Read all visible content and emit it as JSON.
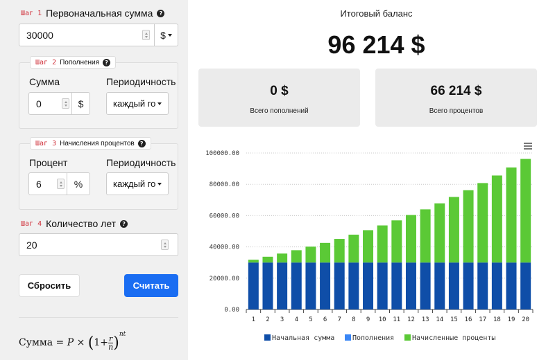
{
  "steps": {
    "s1": {
      "tag": "Шаг 1",
      "label": "Первоначальная сумма",
      "value": "30000",
      "currency": "$"
    },
    "s2": {
      "tag": "Шаг 2",
      "label": "Пополнения",
      "amount_label": "Сумма",
      "amount_value": "0",
      "amount_unit": "$",
      "period_label": "Периодичность",
      "period_value": "каждый го"
    },
    "s3": {
      "tag": "Шаг 3",
      "label": "Начисления процентов",
      "rate_label": "Процент",
      "rate_value": "6",
      "rate_unit": "%",
      "period_label": "Периодичность",
      "period_value": "каждый го"
    },
    "s4": {
      "tag": "Шаг 4",
      "label": "Количество лет",
      "value": "20"
    }
  },
  "buttons": {
    "reset": "Сбросить",
    "calc": "Считать"
  },
  "formula": "Сумма = P × (1 + r/n)^nt",
  "summary": {
    "title": "Итоговый баланс",
    "total": "96 214 $",
    "contrib_value": "0 $",
    "contrib_label": "Всего пополнений",
    "interest_value": "66 214 $",
    "interest_label": "Всего процентов"
  },
  "menu_icon": "hamburger-menu-icon",
  "colors": {
    "initial": "#0f4ea8",
    "contrib": "#3a86f5",
    "interest": "#5bc936",
    "calc_button": "#1a6df2",
    "step_tag": "#d0313b"
  },
  "chart_data": {
    "type": "bar",
    "stacked": true,
    "categories": [
      "1",
      "2",
      "3",
      "4",
      "5",
      "6",
      "7",
      "8",
      "9",
      "10",
      "11",
      "12",
      "13",
      "14",
      "15",
      "16",
      "17",
      "18",
      "19",
      "20"
    ],
    "series": [
      {
        "name": "Начальная сумма",
        "values": [
          30000,
          30000,
          30000,
          30000,
          30000,
          30000,
          30000,
          30000,
          30000,
          30000,
          30000,
          30000,
          30000,
          30000,
          30000,
          30000,
          30000,
          30000,
          30000,
          30000
        ]
      },
      {
        "name": "Пополнения",
        "values": [
          0,
          0,
          0,
          0,
          0,
          0,
          0,
          0,
          0,
          0,
          0,
          0,
          0,
          0,
          0,
          0,
          0,
          0,
          0,
          0
        ]
      },
      {
        "name": "Начисленные проценты",
        "values": [
          1800,
          3708,
          5730,
          7874,
          10147,
          12556,
          15109,
          17815,
          20684,
          23725,
          26949,
          30366,
          33988,
          37827,
          41897,
          46211,
          50783,
          55630,
          60768,
          66214
        ]
      }
    ],
    "yticks": [
      "0.00",
      "20000.00",
      "40000.00",
      "60000.00",
      "80000.00",
      "100000.00"
    ],
    "ylim": [
      0,
      100000
    ],
    "grid": true,
    "legend": "bottom"
  }
}
